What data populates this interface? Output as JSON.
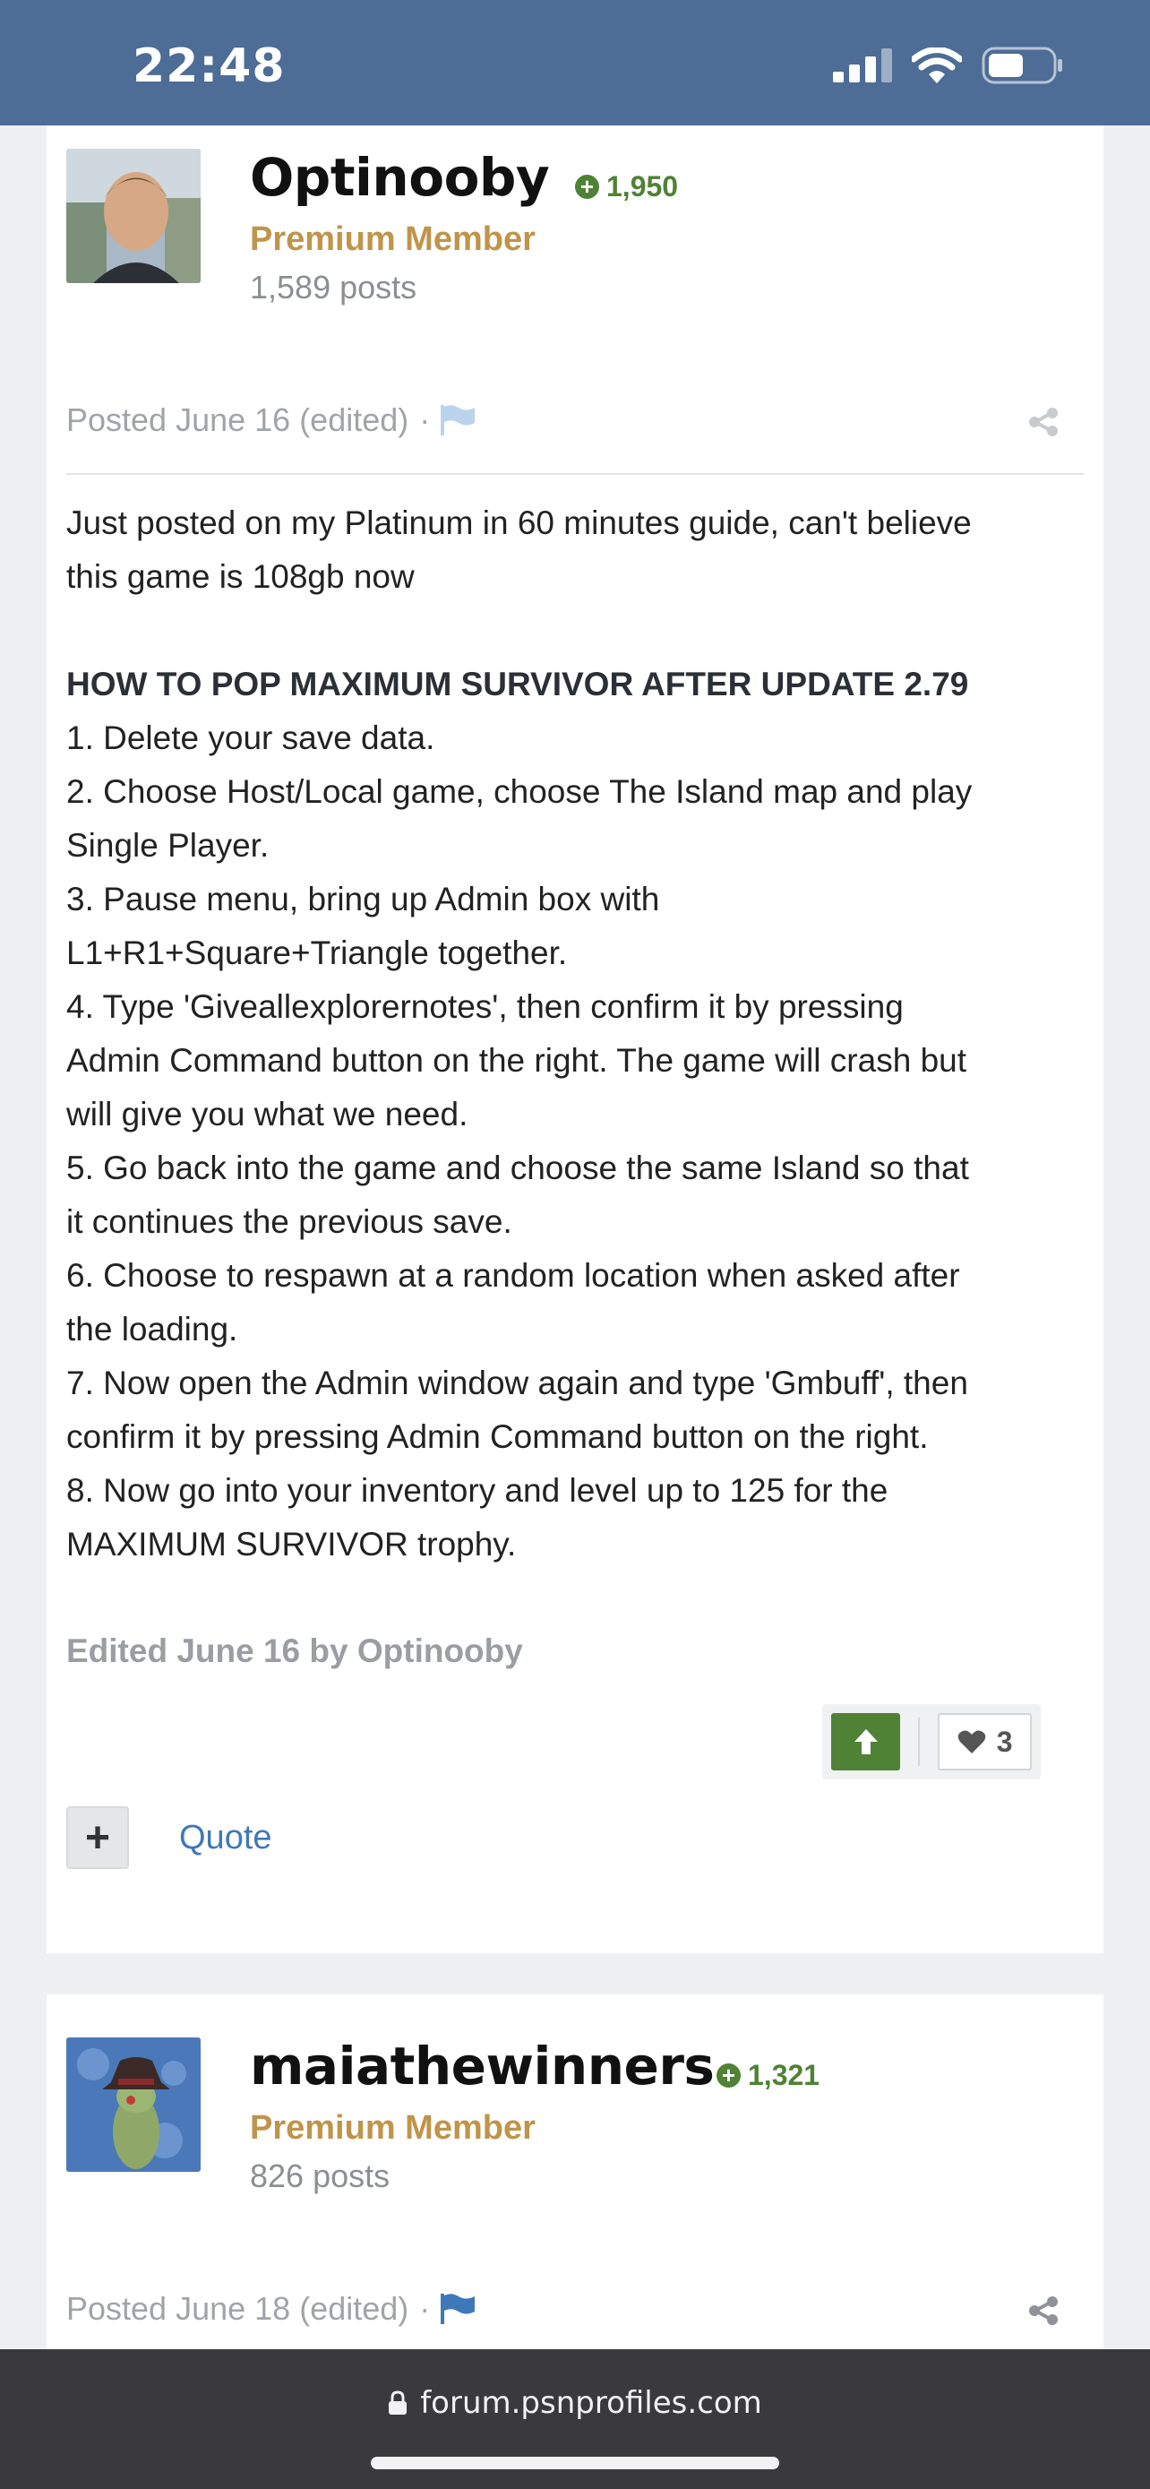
{
  "status_bar": {
    "time": "22:48"
  },
  "posts": [
    {
      "author": "Optinooby",
      "reputation": "1,950",
      "member_title": "Premium Member",
      "post_count": "1,589 posts",
      "posted": "Posted June 16 (edited)",
      "meta_dot": "·",
      "body": {
        "intro": [
          "Just posted on my Platinum in 60 minutes guide, can't believe",
          "this game is 108gb now"
        ],
        "heading": "HOW TO POP MAXIMUM SURVIVOR AFTER UPDATE 2.79",
        "steps": [
          [
            "1. Delete your save data."
          ],
          [
            "2. Choose Host/Local game, choose The Island map and play",
            "Single Player."
          ],
          [
            "3. Pause menu, bring up Admin box with",
            "L1+R1+Square+Triangle together."
          ],
          [
            "4. Type 'Giveallexplorernotes', then confirm it by pressing",
            "Admin Command button on the right. The game will crash but",
            "will give you what we need."
          ],
          [
            "5. Go back into the game and choose the same Island so that",
            "it continues the previous save."
          ],
          [
            "6. Choose to respawn at a random location when asked after",
            "the loading."
          ],
          [
            "7. Now open the Admin window again and type 'Gmbuff', then",
            "confirm it by pressing Admin Command button on the right."
          ],
          [
            "8. Now go into your inventory and level up to 125 for the",
            "MAXIMUM SURVIVOR trophy."
          ]
        ]
      },
      "edited_note": "Edited June 16 by Optinooby",
      "like_count": "3",
      "multiquote_label": "+",
      "quote_label": "Quote"
    },
    {
      "author": "maiathewinners",
      "reputation": "1,321",
      "member_title": "Premium Member",
      "post_count": "826 posts",
      "posted": "Posted June 18 (edited)",
      "meta_dot": "·"
    }
  ],
  "browser": {
    "url": "forum.psnprofiles.com"
  },
  "colors": {
    "status_bar": "#4d6c96",
    "reputation_green": "#4f8235",
    "premium_gold": "#c0944a",
    "link_blue": "#3f78b8",
    "url_bar": "#3a3a3c"
  },
  "icons": [
    "cellular-signal-icon",
    "wifi-icon",
    "battery-icon",
    "reputation-plus-icon",
    "report-flag-icon",
    "share-icon",
    "upvote-arrow-icon",
    "heart-icon",
    "lock-icon"
  ]
}
